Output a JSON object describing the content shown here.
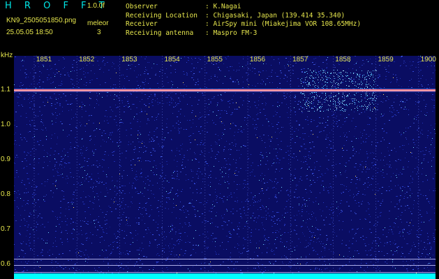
{
  "header": {
    "app_title": "H R O F F T",
    "version": "1.0.0f",
    "filename": "KN9_2505051850.png",
    "mode": "meleor",
    "datetime": "25.05.05 18:50",
    "count": "3"
  },
  "station": [
    {
      "label": "Observer",
      "value": ": K.Nagai"
    },
    {
      "label": "Receiving Location",
      "value": ": Chigasaki, Japan (139.414 35.340)"
    },
    {
      "label": "Receiver",
      "value": ": AirSpy mini (Miakejima VOR 108.65MHz)"
    },
    {
      "label": "Receiving antenna",
      "value": ": Maspro FM-3"
    }
  ],
  "axes": {
    "y_unit": "kHz",
    "x_ticks": [
      "1851",
      "1852",
      "1853",
      "1854",
      "1855",
      "1856",
      "1857",
      "1858",
      "1859",
      "1900"
    ],
    "y_ticks": [
      "1.1",
      "1.0",
      "0.9",
      "0.8",
      "0.7",
      "0.6"
    ]
  },
  "colors": {
    "background": "#0a0d62",
    "noise": "#2a3fd0",
    "carrier": "#ff5a6e",
    "cyan": "#00ffff",
    "label": "#e6e64d"
  }
}
